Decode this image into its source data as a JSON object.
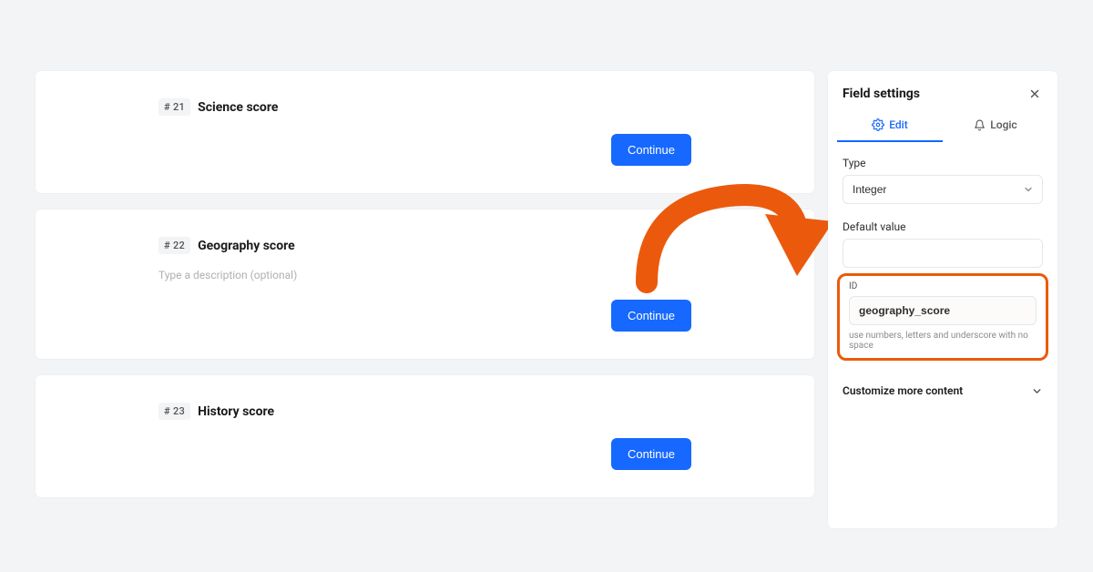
{
  "list": [
    {
      "num": "# 21",
      "title": "Science score",
      "continue": "Continue",
      "desc": ""
    },
    {
      "num": "# 22",
      "title": "Geography score",
      "continue": "Continue",
      "desc": "Type a description (optional)"
    },
    {
      "num": "# 23",
      "title": "History score",
      "continue": "Continue",
      "desc": ""
    }
  ],
  "sidebar": {
    "title": "Field settings",
    "tabs": {
      "edit": "Edit",
      "logic": "Logic"
    },
    "type_label": "Type",
    "type_value": "Integer",
    "default_label": "Default value",
    "default_value": "",
    "id_label": "ID",
    "id_value": "geography_score",
    "id_hint": "use numbers, letters and underscore with no space",
    "accordion": "Customize more content"
  }
}
